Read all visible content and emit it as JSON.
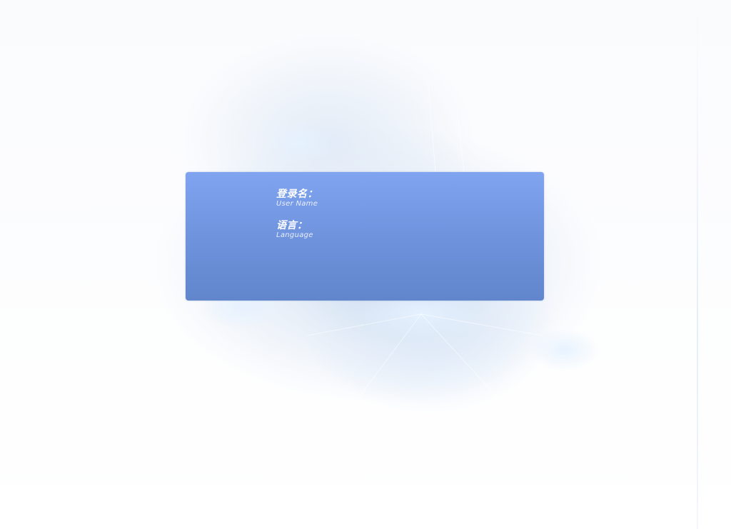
{
  "login": {
    "username": {
      "label_zh": "登录名：",
      "label_en": "User Name"
    },
    "language": {
      "label_zh": "语言：",
      "label_en": "Language"
    }
  },
  "colors": {
    "panel_top": "#80a4ef",
    "panel_bottom": "#6286cc",
    "label_text": "#ffffff",
    "background": "#ffffff"
  }
}
